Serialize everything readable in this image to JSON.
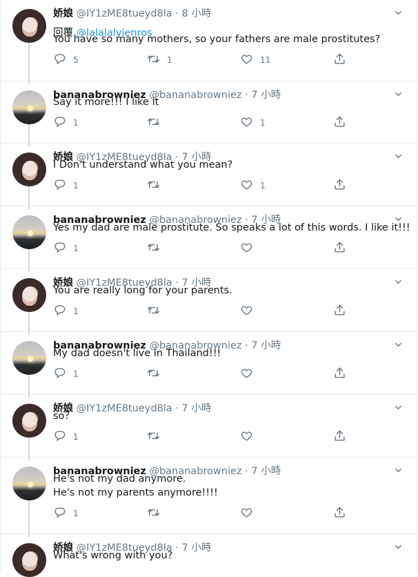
{
  "tweets": [
    {
      "user": "娇娘",
      "handle": "@IY1zME8tueyd8la",
      "sep": " · ",
      "time": "8 小時",
      "reply_prefix": "回覆 ",
      "reply_to": "@lalalalvienros",
      "lines": [
        "You have so many mothers, so your fathers are male prostitutes?"
      ],
      "replies": "5",
      "retweets": "1",
      "likes": "11",
      "avatar": "girl"
    },
    {
      "user": "bananabrowniez",
      "handle": "@bananabrowniez",
      "sep": " · ",
      "time": "7 小時",
      "lines": [
        "Say it more!!! I like it"
      ],
      "replies": "1",
      "retweets": "",
      "likes": "1",
      "avatar": "sunset"
    },
    {
      "user": "娇娘",
      "handle": "@IY1zME8tueyd8la",
      "sep": " · ",
      "time": "7 小時",
      "lines": [
        "I Don't understand what you mean?"
      ],
      "replies": "1",
      "retweets": "",
      "likes": "1",
      "avatar": "girl"
    },
    {
      "user": "bananabrowniez",
      "handle": "@bananabrowniez",
      "sep": " · ",
      "time": "7 小時",
      "lines": [
        "Yes my dad are male prostitute. So speaks a lot of this words. I like it!!!"
      ],
      "replies": "1",
      "retweets": "",
      "likes": "",
      "avatar": "sunset"
    },
    {
      "user": "娇娘",
      "handle": "@IY1zME8tueyd8la",
      "sep": " · ",
      "time": "7 小時",
      "lines": [
        "You are really long for your parents."
      ],
      "replies": "1",
      "retweets": "",
      "likes": "",
      "avatar": "girl"
    },
    {
      "user": "bananabrowniez",
      "handle": "@bananabrowniez",
      "sep": " · ",
      "time": "7 小時",
      "lines": [
        "My dad doesn't live in Thailand!!!"
      ],
      "replies": "1",
      "retweets": "",
      "likes": "",
      "avatar": "sunset"
    },
    {
      "user": "娇娘",
      "handle": "@IY1zME8tueyd8la",
      "sep": " · ",
      "time": "7 小時",
      "lines": [
        "so？"
      ],
      "replies": "1",
      "retweets": "",
      "likes": "",
      "avatar": "girl"
    },
    {
      "user": "bananabrowniez",
      "handle": "@bananabrowniez",
      "sep": " · ",
      "time": "7 小時",
      "lines": [
        "He's not my dad anymore.",
        "He's not my parents anymore!!!!"
      ],
      "replies": "1",
      "retweets": "",
      "likes": "",
      "avatar": "sunset"
    },
    {
      "user": "娇娘",
      "handle": "@IY1zME8tueyd8la",
      "sep": " · ",
      "time": "7 小時",
      "lines": [
        "What's wrong with you?"
      ],
      "replies": "",
      "retweets": "",
      "likes": "",
      "avatar": "girl"
    }
  ],
  "icons": {
    "reply": "reply-icon",
    "retweet": "retweet-icon",
    "like": "heart-icon",
    "share": "share-icon",
    "more": "chevron-down-icon"
  },
  "colors": {
    "text": "#14171a",
    "muted": "#657786",
    "link": "#1b95e0",
    "border": "#e6ecf0",
    "thread": "#ccd6dd"
  }
}
